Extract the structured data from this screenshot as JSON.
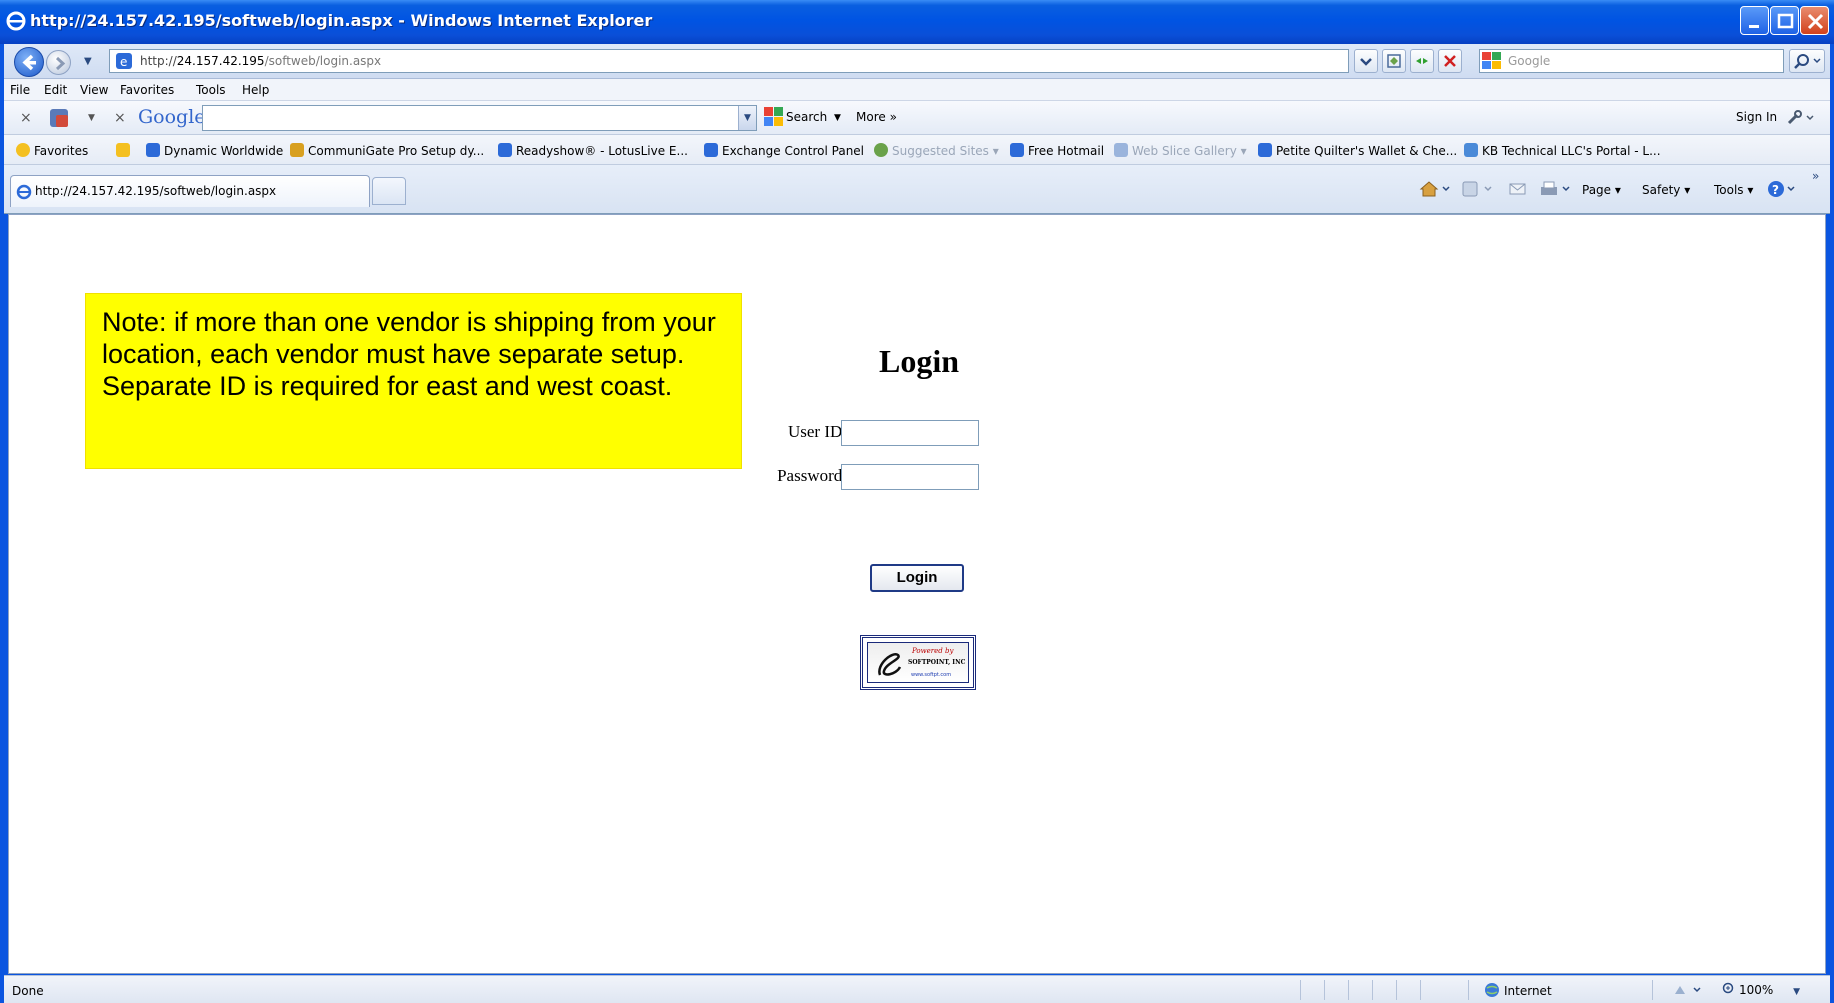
{
  "window": {
    "title": "http://24.157.42.195/softweb/login.aspx - Windows Internet Explorer"
  },
  "address_bar": {
    "prefix": "http://",
    "host": "24.157.42.195",
    "path": "/softweb/login.aspx"
  },
  "search_box": {
    "placeholder": "Google"
  },
  "menu": {
    "items": [
      "File",
      "Edit",
      "View",
      "Favorites",
      "Tools",
      "Help"
    ]
  },
  "google_toolbar": {
    "logo": "Google",
    "search_label": "Search",
    "more_label": "More »",
    "sign_in_label": "Sign In"
  },
  "favorites_bar": {
    "favorites_label": "Favorites",
    "items": [
      "Dynamic Worldwide",
      "CommuniGate Pro Setup dy...",
      "Readyshow® - LotusLive E...",
      "Exchange Control Panel",
      "Suggested Sites ▾",
      "Free Hotmail",
      "Web Slice Gallery ▾",
      "Petite Quilter's Wallet & Che...",
      "KB Technical LLC's Portal - L..."
    ]
  },
  "tabs": {
    "active_title": "http://24.157.42.195/softweb/login.aspx"
  },
  "command_bar": {
    "page_label": "Page ▾",
    "safety_label": "Safety ▾",
    "tools_label": "Tools ▾"
  },
  "page": {
    "note": "Note:  if more than one vendor is shipping from your location, each vendor must have separate setup.  Separate ID is required for east and west coast.",
    "login_title": "Login",
    "user_id_label": "User ID:",
    "password_label": "Password:",
    "user_id_value": "",
    "password_value": "",
    "login_button": "Login",
    "badge": {
      "line1": "Powered by",
      "line2": "SOFTPOINT, INC",
      "line3": "www.softpt.com"
    }
  },
  "status_bar": {
    "status": "Done",
    "zone": "Internet",
    "zoom": "100%"
  }
}
